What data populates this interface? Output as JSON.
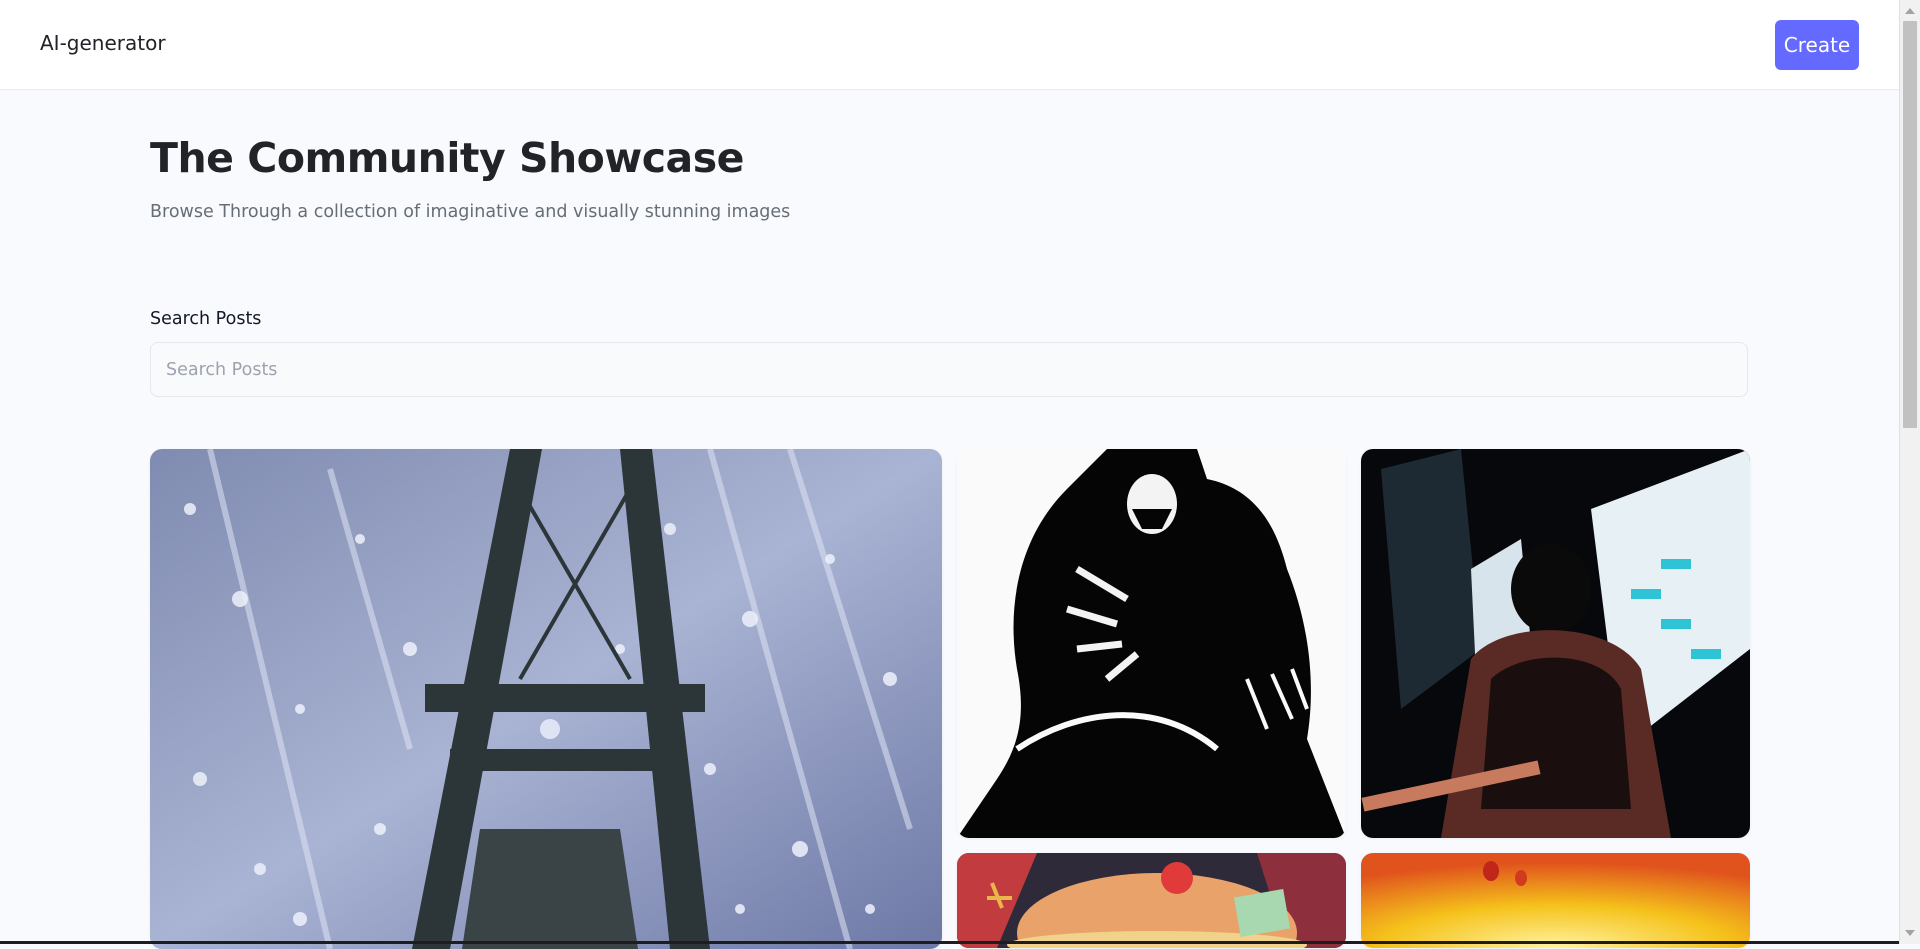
{
  "header": {
    "logo": "AI-generator",
    "create_label": "Create"
  },
  "hero": {
    "title": "The Community Showcase",
    "subtitle": "Browse Through a collection of imaginative and visually stunning images"
  },
  "search": {
    "label": "Search Posts",
    "placeholder": "Search Posts",
    "value": ""
  },
  "gallery": {
    "images": [
      {
        "subject": "steel tower among falling crystal shards"
      },
      {
        "subject": "black and white hooded creature with claws"
      },
      {
        "subject": "dark silhouette among neon city buildings"
      },
      {
        "subject": "colorful burger illustration"
      },
      {
        "subject": "warm yellow orange abstract glow"
      }
    ]
  },
  "colors": {
    "accent": "#6469ff",
    "background": "#f9fafe",
    "text_primary": "#222328",
    "text_secondary": "#666e75"
  }
}
